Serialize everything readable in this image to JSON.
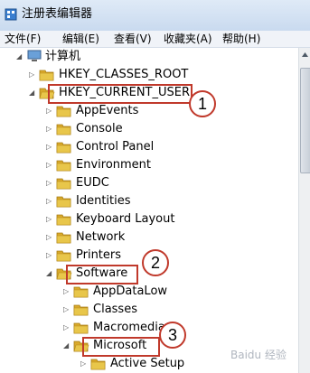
{
  "window": {
    "title": "注册表编辑器"
  },
  "menu": [
    {
      "label": "文件(F)"
    },
    {
      "label": "编辑(E)"
    },
    {
      "label": "查看(V)"
    },
    {
      "label": "收藏夹(A)"
    },
    {
      "label": "帮助(H)"
    }
  ],
  "tree": {
    "root": "计算机",
    "items": [
      {
        "label": "HKEY_CLASSES_ROOT",
        "expanded": false
      },
      {
        "label": "HKEY_CURRENT_USER",
        "expanded": true
      },
      {
        "label": "AppEvents"
      },
      {
        "label": "Console"
      },
      {
        "label": "Control Panel"
      },
      {
        "label": "Environment"
      },
      {
        "label": "EUDC"
      },
      {
        "label": "Identities"
      },
      {
        "label": "Keyboard Layout"
      },
      {
        "label": "Network"
      },
      {
        "label": "Printers"
      },
      {
        "label": "Software",
        "expanded": true
      },
      {
        "label": "AppDataLow"
      },
      {
        "label": "Classes"
      },
      {
        "label": "Macromedia"
      },
      {
        "label": "Microsoft",
        "expanded": true
      },
      {
        "label": "Active Setup"
      }
    ]
  },
  "callouts": [
    "1",
    "2",
    "3"
  ],
  "watermark": "Baidu 经验",
  "colors": {
    "highlight": "#c0392b",
    "folder": "#e8c64a"
  }
}
